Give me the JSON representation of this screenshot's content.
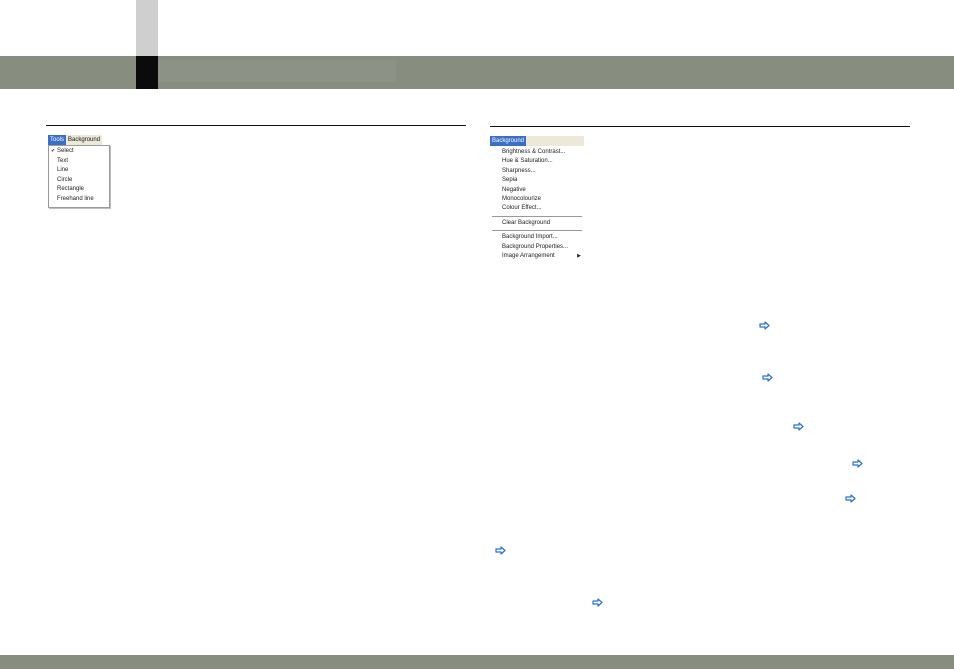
{
  "header": {
    "accent_color": "#878e80",
    "marker_color": "#0b0b0b"
  },
  "tools_menu": {
    "menubar": [
      "Tools",
      "Background"
    ],
    "items": [
      "Select",
      "Text",
      "Line",
      "Circle",
      "Rectangle",
      "Freehand line"
    ],
    "checked_item": "Select"
  },
  "background_menu": {
    "menubar": [
      "Background"
    ],
    "group1": [
      "Brightness & Contrast...",
      "Hue & Saturation...",
      "Sharpness...",
      "Sepia",
      "Negative",
      "Monocolourize",
      "Colour Effect..."
    ],
    "group2": [
      "Clear Background"
    ],
    "group3": [
      "Background Import...",
      "Background Properties...",
      "Image Arrangement"
    ]
  },
  "icons": {
    "link_arrow": "arrow-right-outline-icon",
    "arrow_color": "#2a6fd6"
  }
}
